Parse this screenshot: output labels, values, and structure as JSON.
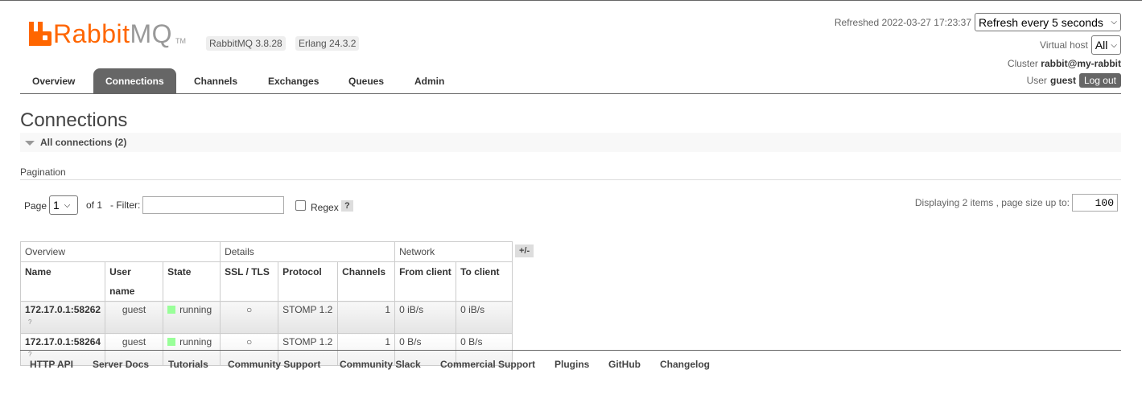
{
  "brand": {
    "name_rabbit": "Rabbit",
    "name_mq": "MQ",
    "tm": "TM"
  },
  "versions": {
    "rabbitmq": "RabbitMQ 3.8.28",
    "erlang": "Erlang 24.3.2"
  },
  "status": {
    "refreshed": "Refreshed 2022-03-27 17:23:37",
    "refresh_select": "Refresh every 5 seconds",
    "virtual_host_label": "Virtual host",
    "virtual_host_value": "All",
    "cluster_label": "Cluster",
    "cluster_value": "rabbit@my-rabbit",
    "user_label": "User",
    "user_value": "guest",
    "logout": "Log out"
  },
  "nav": {
    "tabs": [
      {
        "label": "Overview"
      },
      {
        "label": "Connections",
        "active": true
      },
      {
        "label": "Channels"
      },
      {
        "label": "Exchanges"
      },
      {
        "label": "Queues"
      },
      {
        "label": "Admin"
      }
    ]
  },
  "page_title": "Connections",
  "section": {
    "title": "All connections (2)"
  },
  "pagination": {
    "label": "Pagination",
    "page_label": "Page",
    "page_value": "1",
    "of_label": "of 1",
    "filter_label": "- Filter:",
    "filter_value": "",
    "regex_label": "Regex",
    "help": "?",
    "displaying": "Displaying 2 items , page size up to:",
    "page_size": "100"
  },
  "table": {
    "groups": [
      "Overview",
      "Details",
      "Network"
    ],
    "columns": [
      "Name",
      "User name",
      "State",
      "SSL / TLS",
      "Protocol",
      "Channels",
      "From client",
      "To client"
    ],
    "plus_minus": "+/-",
    "rows": [
      {
        "name": "172.17.0.1:58262",
        "q": "?",
        "user": "guest",
        "state": "running",
        "ssl": "○",
        "protocol": "STOMP 1.2",
        "channels": "1",
        "from": "0 iB/s",
        "to": "0 iB/s"
      },
      {
        "name": "172.17.0.1:58264",
        "q": "?",
        "user": "guest",
        "state": "running",
        "ssl": "○",
        "protocol": "STOMP 1.2",
        "channels": "1",
        "from": "0 B/s",
        "to": "0 B/s"
      }
    ]
  },
  "footer": {
    "links": [
      "HTTP API",
      "Server Docs",
      "Tutorials",
      "Community Support",
      "Community Slack",
      "Commercial Support",
      "Plugins",
      "GitHub",
      "Changelog"
    ]
  },
  "colors": {
    "brand_orange": "#ff6600",
    "nav_active": "#666666",
    "running": "#99ff99"
  }
}
